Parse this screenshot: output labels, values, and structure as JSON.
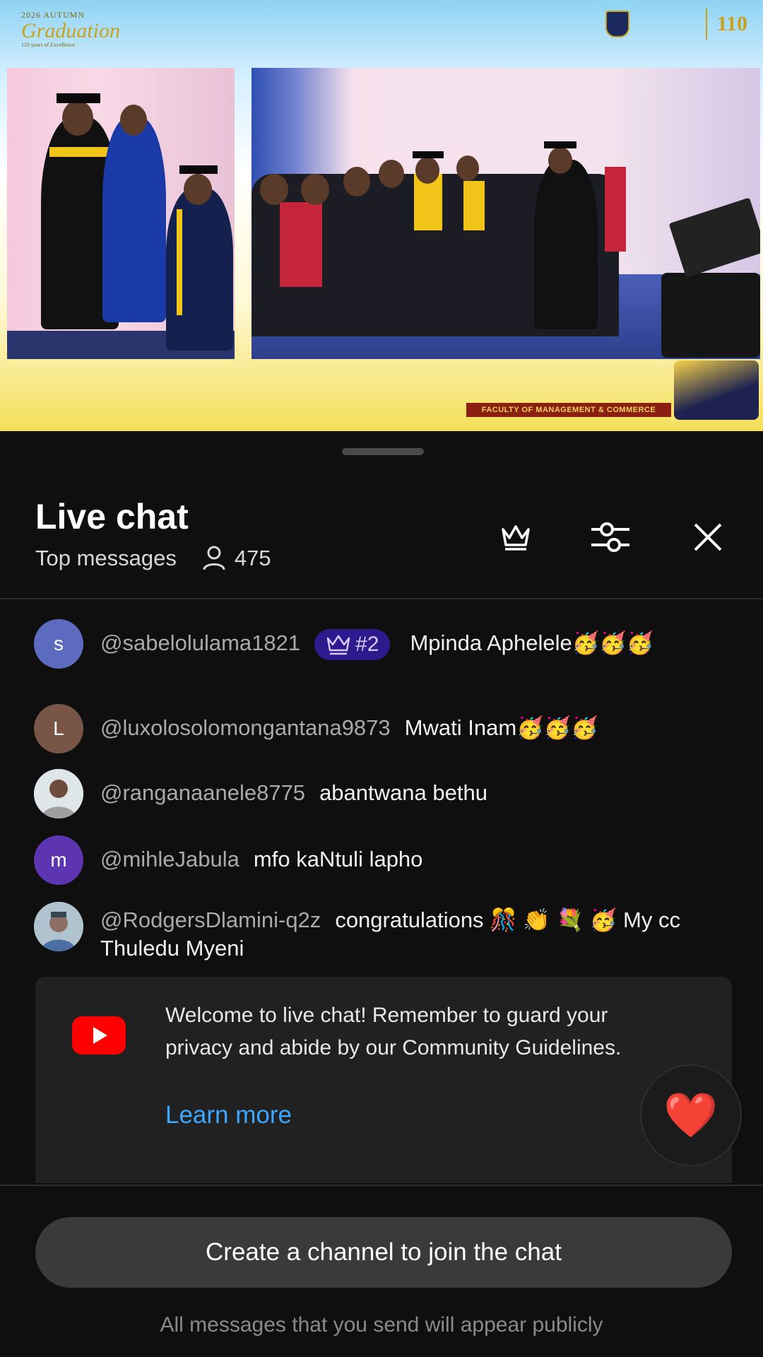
{
  "video": {
    "event_year": "2026 AUTUMN",
    "event_script": "Graduation",
    "event_tagline": "110 years of Excellence",
    "anniversary": "110",
    "faculty_banner": "FACULTY OF MANAGEMENT & COMMERCE"
  },
  "chat": {
    "title": "Live chat",
    "mode": "Top messages",
    "viewer_count": "475",
    "icons": [
      "crown-icon",
      "filter-icon",
      "close-icon"
    ],
    "messages": [
      {
        "avatar_letter": "s",
        "avatar_color": "#5c6bc0",
        "author": "@sabelolulama1821",
        "badge": "#2",
        "text": "Mpinda Aphelele🥳🥳🥳"
      },
      {
        "avatar_letter": "L",
        "avatar_color": "#795548",
        "author": "@luxolosolomongantana9873",
        "text": "Mwati Inam🥳🥳🥳"
      },
      {
        "avatar_letter": "",
        "avatar_color": "#cfd8dc",
        "author": "@ranganaanele8775",
        "text": "abantwana bethu"
      },
      {
        "avatar_letter": "m",
        "avatar_color": "#5e35b1",
        "author": "@mihleJabula",
        "text": "mfo kaNtuli lapho"
      },
      {
        "avatar_letter": "",
        "avatar_color": "#90a4ae",
        "author": "@RodgersDlamini-q2z",
        "text": "congratulations 🎊 👏 💐 🥳 My cc Thuledu Myeni"
      }
    ],
    "welcome_text": "Welcome to live chat! Remember to guard your privacy and abide by our Community Guidelines.",
    "learn_more": "Learn more",
    "heart": "❤️",
    "create_channel": "Create a channel to join the chat",
    "footer_note": "All messages that you send will appear publicly",
    "accent": "#3ea6ff"
  }
}
